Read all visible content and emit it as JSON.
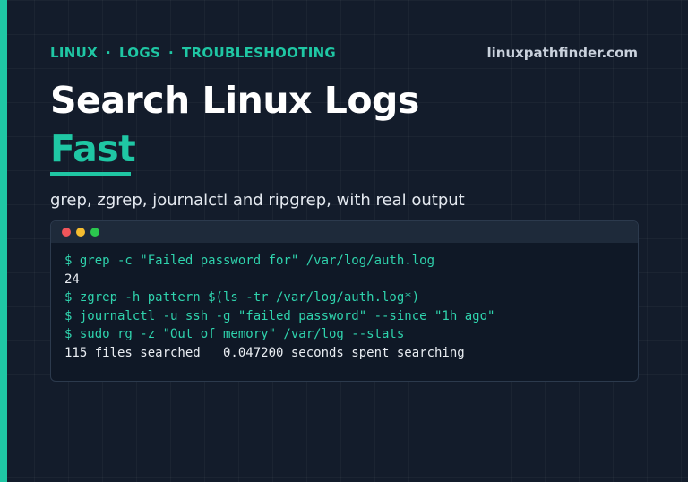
{
  "tags": [
    "LINUX",
    "LOGS",
    "TROUBLESHOOTING"
  ],
  "tag_separator": "·",
  "site": "linuxpathfinder.com",
  "title": {
    "line1": "Search Linux Logs",
    "line2": "Fast"
  },
  "subtitle": "grep, zgrep, journalctl and ripgrep, with real output",
  "terminal": {
    "window_buttons": [
      "close-dot",
      "minimize-dot",
      "maximize-dot"
    ],
    "lines": [
      {
        "type": "cmd",
        "text": "$ grep -c \"Failed password for\" /var/log/auth.log"
      },
      {
        "type": "out",
        "text": "24"
      },
      {
        "type": "cmd",
        "text": "$ zgrep -h pattern $(ls -tr /var/log/auth.log*)"
      },
      {
        "type": "cmd",
        "text": "$ journalctl -u ssh -g \"failed password\" --since \"1h ago\""
      },
      {
        "type": "cmd",
        "text": "$ sudo rg -z \"Out of memory\" /var/log --stats"
      },
      {
        "type": "out",
        "text": "115 files searched   0.047200 seconds spent searching"
      }
    ]
  },
  "colors": {
    "accent": "#1fc7a4",
    "background": "#131c2b",
    "command_text": "#2fd3ad",
    "output_text": "#e9edf2"
  }
}
